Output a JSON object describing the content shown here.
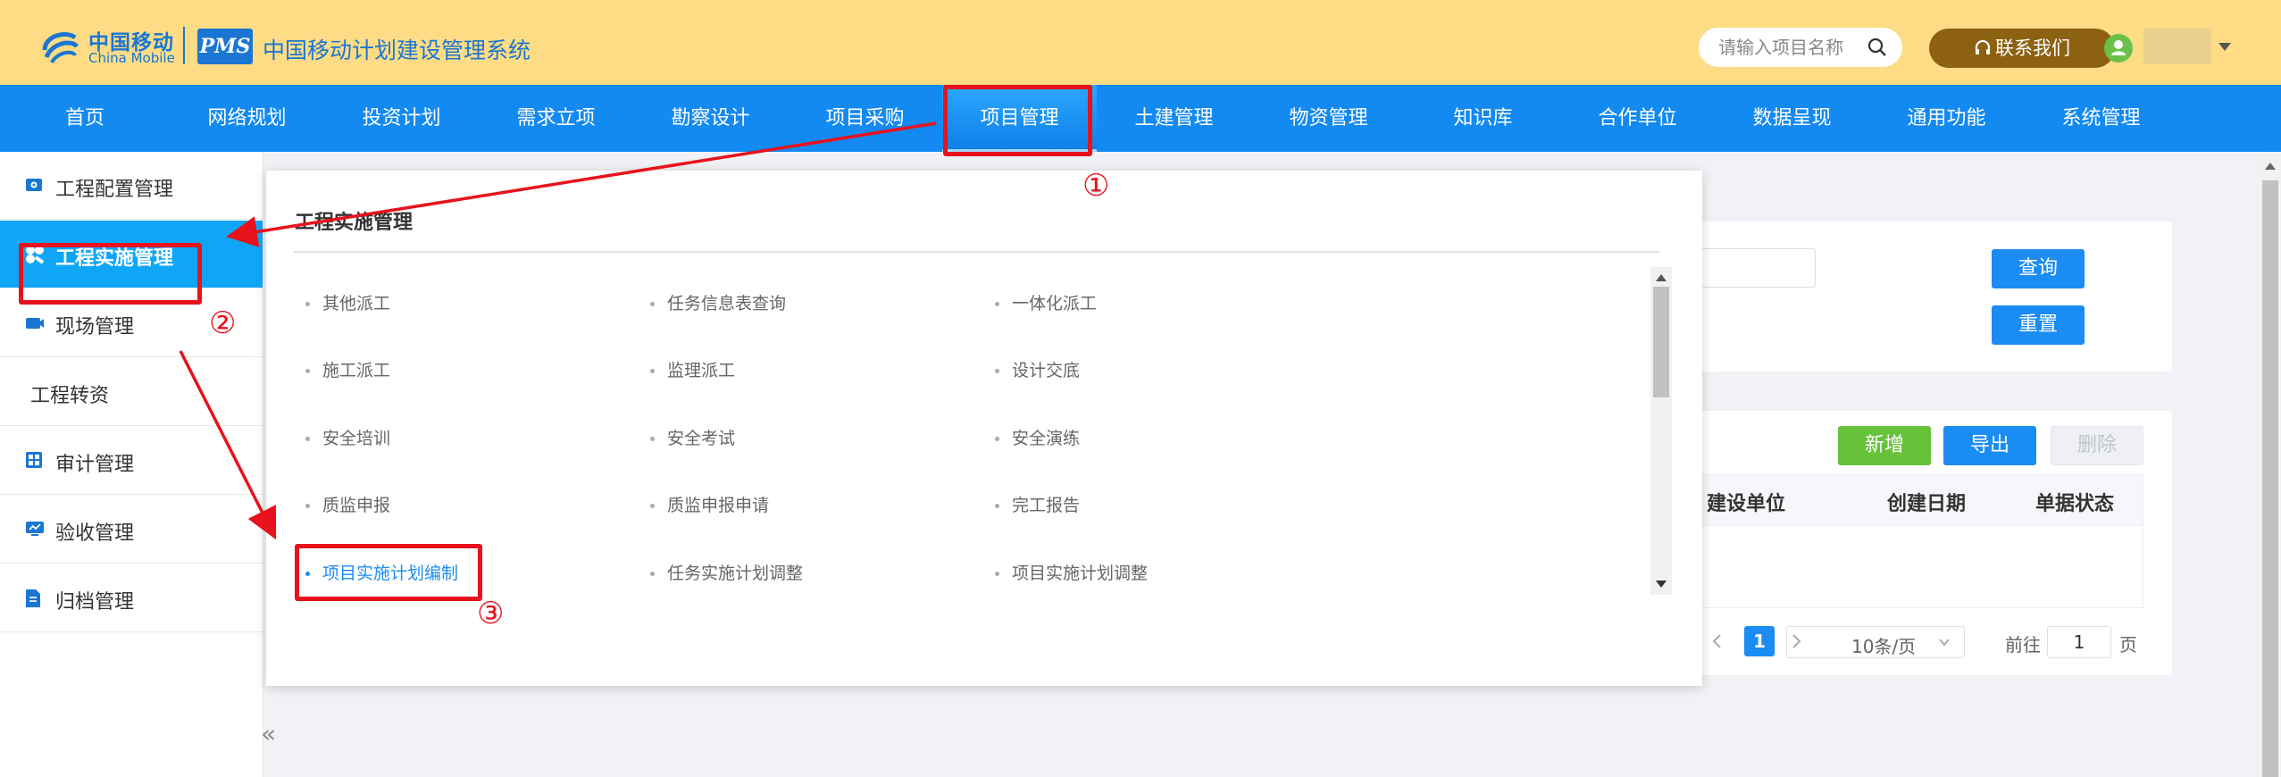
{
  "header": {
    "logo_cn": "中国移动",
    "logo_en": "China Mobile",
    "pms_logo": "PMS",
    "system_title": "中国移动计划建设管理系统",
    "search_placeholder": "请输入项目名称",
    "contact_label": "联系我们",
    "colors": {
      "background": "#fddc85",
      "brand_blue": "#1a76d2",
      "contact_button": "#8c6112"
    }
  },
  "nav": {
    "items": [
      "首页",
      "网络规划",
      "投资计划",
      "需求立项",
      "勘察设计",
      "项目采购",
      "项目管理",
      "土建管理",
      "物资管理",
      "知识库",
      "合作单位",
      "数据呈现",
      "通用功能",
      "系统管理"
    ],
    "active": "项目管理",
    "color": "#1389f2"
  },
  "sidebar": {
    "items": [
      {
        "label": "工程配置管理",
        "icon": "settings-icon"
      },
      {
        "label": "工程实施管理",
        "icon": "tools-icon",
        "active": true
      },
      {
        "label": "现场管理",
        "icon": "camera-icon"
      },
      {
        "label": "工程转资",
        "icon": ""
      },
      {
        "label": "审计管理",
        "icon": "grid-icon"
      },
      {
        "label": "验收管理",
        "icon": "monitor-icon"
      },
      {
        "label": "归档管理",
        "icon": "document-icon"
      }
    ],
    "collapse": "«"
  },
  "content": {
    "query_button": "查询",
    "reset_button": "重置",
    "add_button": "新增",
    "export_button": "导出",
    "delete_button": "删除",
    "table_headers": [
      "建设单位",
      "创建日期",
      "单据状态"
    ],
    "pager": {
      "current_page": "1",
      "page_size": "10条/页",
      "goto_prefix": "前往",
      "goto_value": "1",
      "goto_suffix": "页"
    }
  },
  "dropdown": {
    "title": "工程实施管理",
    "columns": [
      [
        "其他派工",
        "施工派工",
        "安全培训",
        "质监申报",
        "项目实施计划编制"
      ],
      [
        "任务信息表查询",
        "监理派工",
        "安全考试",
        "质监申报申请",
        "任务实施计划调整"
      ],
      [
        "一体化派工",
        "设计交底",
        "安全演练",
        "完工报告",
        "项目实施计划调整"
      ]
    ],
    "highlighted": "项目实施计划编制"
  },
  "annotations": {
    "step1": "①",
    "step2": "②",
    "step3": "③",
    "color": "#e8121c"
  }
}
